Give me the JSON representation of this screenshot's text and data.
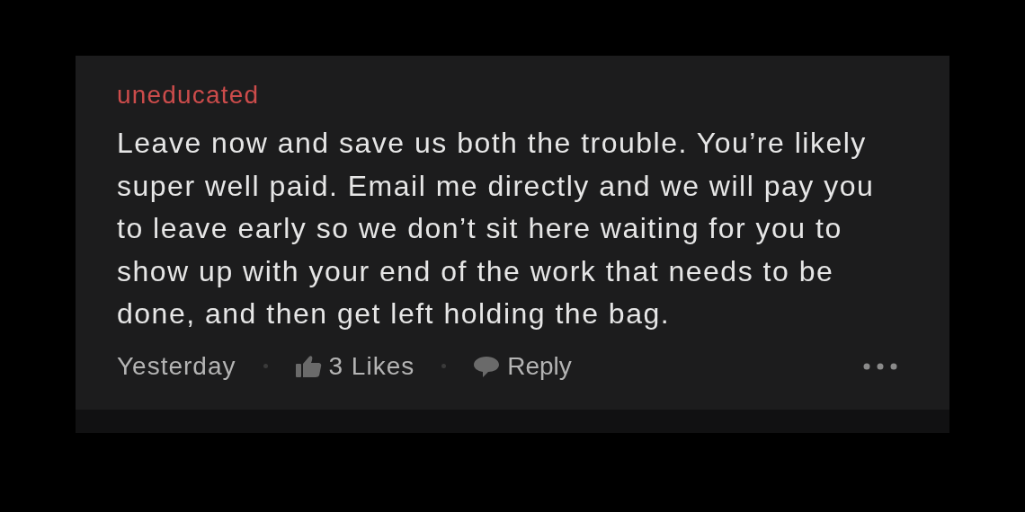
{
  "comment": {
    "author": "uneducated",
    "body": "Leave now and save us both the trouble. You’re likely super well paid. Email me directly and we will pay you to leave early so we don’t sit here waiting for you to show up with your end of the work that needs to be done, and then get left holding the bag.",
    "time": "Yesterday",
    "likes": "3 Likes",
    "reply": "Reply"
  }
}
